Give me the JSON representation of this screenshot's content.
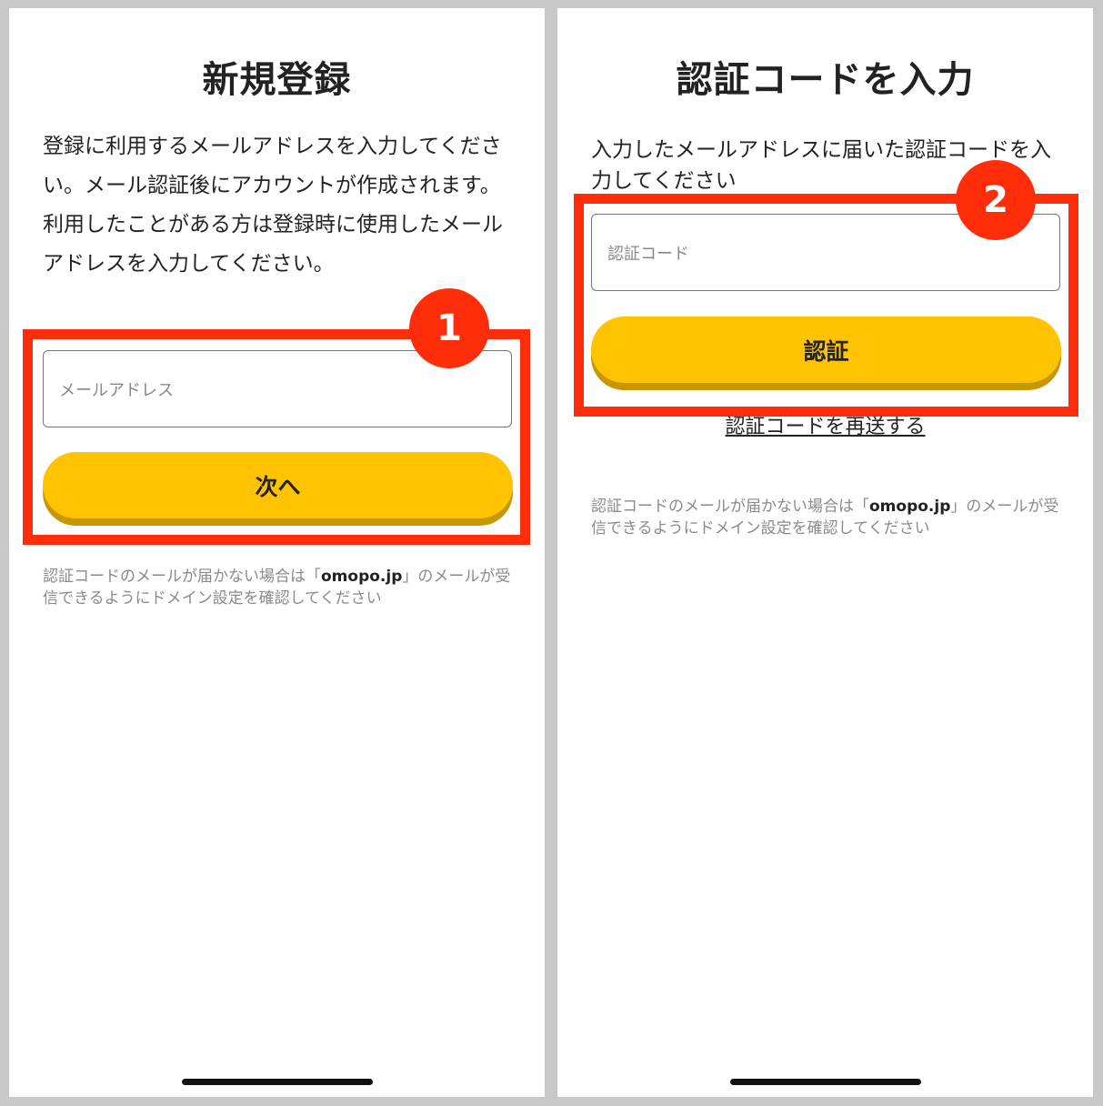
{
  "screens": [
    {
      "title": "新規登録",
      "description": [
        "登録に利用するメールアドレスを入力してください。メール認証後にアカウントが作成されます。",
        "利用したことがある方は登録時に使用したメールアドレスを入力してください。"
      ],
      "input_placeholder": "メールアドレス",
      "button_label": "次へ",
      "step_number": "1",
      "note_prefix": "認証コードのメールが届かない場合は「",
      "note_domain": "omopo.jp",
      "note_suffix": "」のメールが受信できるようにドメイン設定を確認してください"
    },
    {
      "title": "認証コードを入力",
      "description": [
        "入力したメールアドレスに届いた認証コードを入力してください"
      ],
      "input_placeholder": "認証コード",
      "button_label": "認証",
      "step_number": "2",
      "resend_link": "認証コードを再送する",
      "note_prefix": "認証コードのメールが届かない場合は「",
      "note_domain": "omopo.jp",
      "note_suffix": "」のメールが受信できるようにドメイン設定を確認してください"
    }
  ],
  "colors": {
    "accent_yellow": "#ffc300",
    "highlight_red": "#ff2d0a",
    "frame_gray": "#c8c8c8"
  }
}
